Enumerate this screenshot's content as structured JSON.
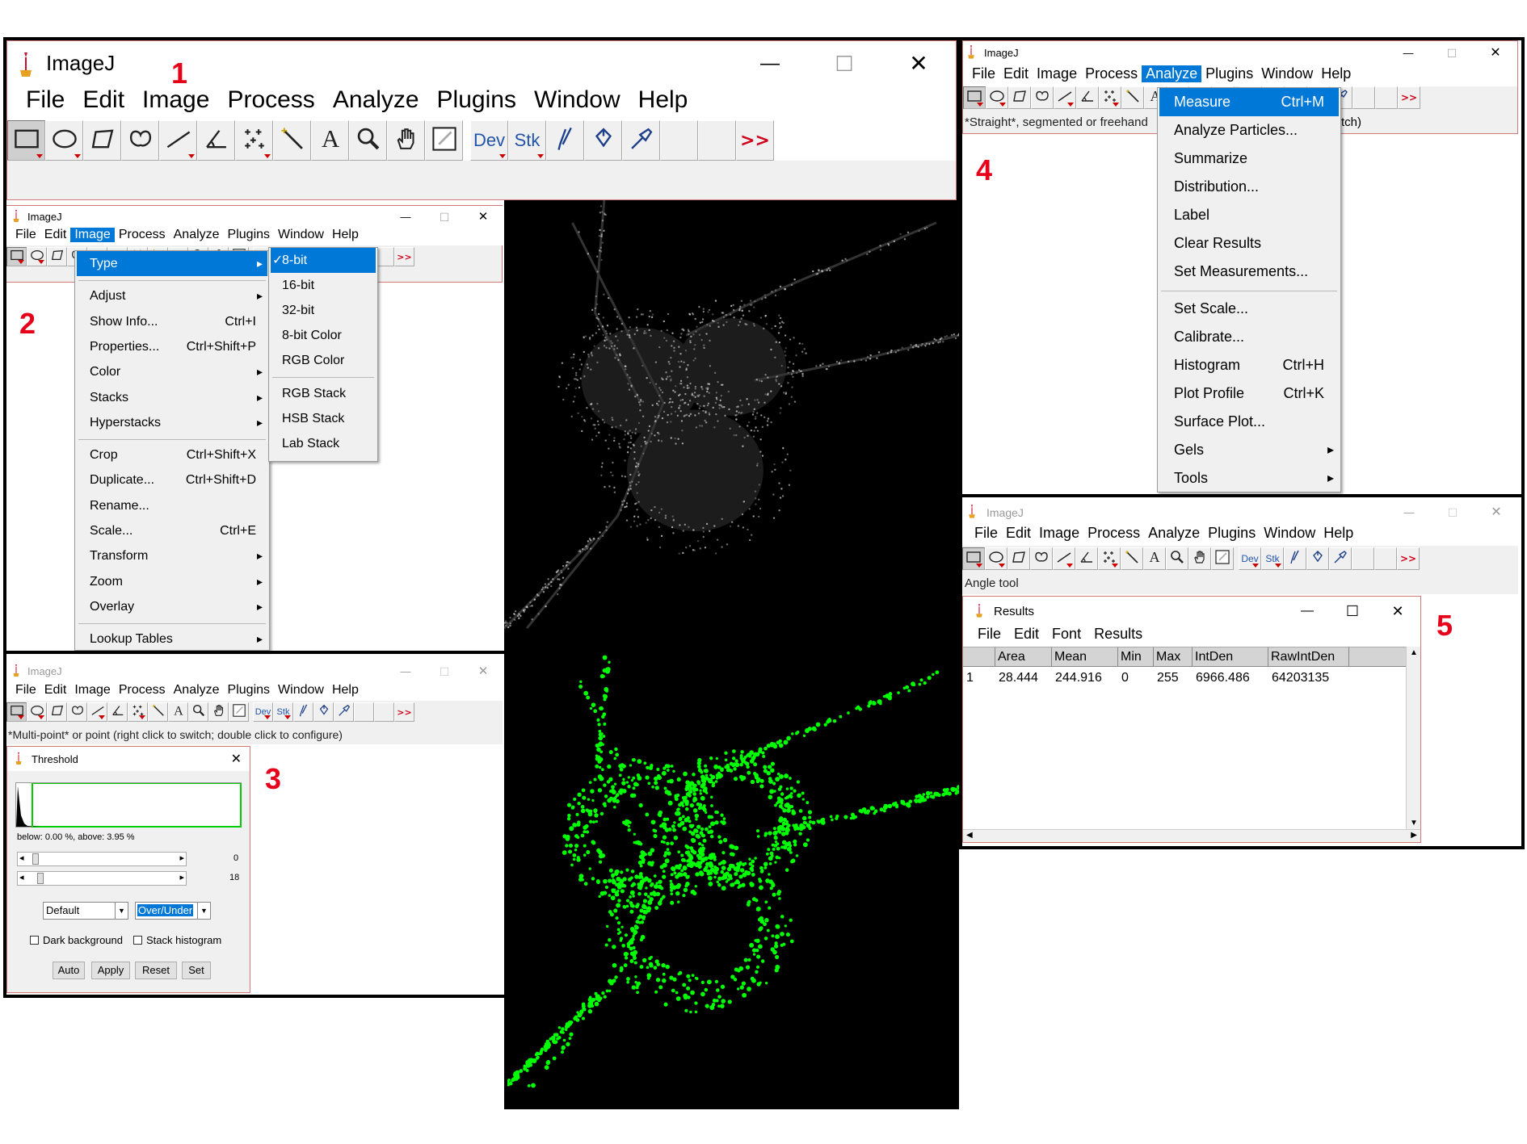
{
  "step_labels": [
    "1",
    "2",
    "3",
    "4",
    "5"
  ],
  "app_title": "ImageJ",
  "window_controls": {
    "minimize": "—",
    "maximize": "☐",
    "close": "✕"
  },
  "menu": [
    "File",
    "Edit",
    "Image",
    "Process",
    "Analyze",
    "Plugins",
    "Window",
    "Help"
  ],
  "tools": {
    "dev": "Dev",
    "stk": "Stk",
    "more": ">>",
    "icons": [
      "rectangle-tool-icon",
      "oval-tool-icon",
      "polygon-tool-icon",
      "freehand-tool-icon",
      "line-tool-icon",
      "angle-tool-icon",
      "multipoint-tool-icon",
      "wand-tool-icon",
      "text-tool-icon",
      "magnifier-tool-icon",
      "hand-tool-icon",
      "color-picker-tool-icon"
    ]
  },
  "win1": {
    "title": "ImageJ"
  },
  "win2": {
    "active_menu": "Image",
    "image_menu": [
      {
        "label": "Type",
        "shortcut": "",
        "submenu": true,
        "highlighted": true
      },
      {
        "label": "Adjust",
        "shortcut": "",
        "submenu": true
      },
      {
        "label": "Show Info...",
        "shortcut": "Ctrl+I"
      },
      {
        "label": "Properties...",
        "shortcut": "Ctrl+Shift+P"
      },
      {
        "label": "Color",
        "shortcut": "",
        "submenu": true
      },
      {
        "label": "Stacks",
        "shortcut": "",
        "submenu": true
      },
      {
        "label": "Hyperstacks",
        "shortcut": "",
        "submenu": true
      },
      {
        "label": "Crop",
        "shortcut": "Ctrl+Shift+X"
      },
      {
        "label": "Duplicate...",
        "shortcut": "Ctrl+Shift+D"
      },
      {
        "label": "Rename...",
        "shortcut": ""
      },
      {
        "label": "Scale...",
        "shortcut": "Ctrl+E"
      },
      {
        "label": "Transform",
        "shortcut": "",
        "submenu": true
      },
      {
        "label": "Zoom",
        "shortcut": "",
        "submenu": true
      },
      {
        "label": "Overlay",
        "shortcut": "",
        "submenu": true
      },
      {
        "label": "Lookup Tables",
        "shortcut": "",
        "submenu": true
      }
    ],
    "type_submenu": [
      {
        "label": "8-bit",
        "checked": true,
        "highlighted": true
      },
      {
        "label": "16-bit"
      },
      {
        "label": "32-bit"
      },
      {
        "label": "8-bit Color"
      },
      {
        "label": "RGB Color"
      },
      {
        "label": "RGB Stack"
      },
      {
        "label": "HSB Stack"
      },
      {
        "label": "Lab Stack"
      }
    ],
    "check_mark": "✓"
  },
  "win3": {
    "status": "*Multi-point* or point (right click to switch; double click to configure)",
    "threshold": {
      "title": "Threshold",
      "stats": "below: 0.00 %,  above: 3.95 %",
      "slider1_value": "0",
      "slider2_value": "18",
      "method": "Default",
      "display_mode": "Over/Under",
      "dark_background": "Dark background",
      "stack_histogram": "Stack histogram",
      "buttons": [
        "Auto",
        "Apply",
        "Reset",
        "Set"
      ]
    }
  },
  "win4": {
    "status_left": "*Straight*, segmented or freehand",
    "status_right": "tch)",
    "active_menu": "Analyze",
    "analyze_menu": [
      {
        "label": "Measure",
        "shortcut": "Ctrl+M",
        "highlighted": true
      },
      {
        "label": "Analyze Particles...",
        "shortcut": ""
      },
      {
        "label": "Summarize",
        "shortcut": ""
      },
      {
        "label": "Distribution...",
        "shortcut": ""
      },
      {
        "label": "Label",
        "shortcut": ""
      },
      {
        "label": "Clear Results",
        "shortcut": ""
      },
      {
        "label": "Set Measurements...",
        "shortcut": ""
      },
      {
        "label": "Set Scale...",
        "shortcut": ""
      },
      {
        "label": "Calibrate...",
        "shortcut": ""
      },
      {
        "label": "Histogram",
        "shortcut": "Ctrl+H"
      },
      {
        "label": "Plot Profile",
        "shortcut": "Ctrl+K"
      },
      {
        "label": "Surface Plot...",
        "shortcut": ""
      },
      {
        "label": "Gels",
        "shortcut": "",
        "submenu": true
      },
      {
        "label": "Tools",
        "shortcut": "",
        "submenu": true
      }
    ]
  },
  "win5": {
    "status": "Angle tool",
    "results": {
      "title": "Results",
      "menu": [
        "File",
        "Edit",
        "Font",
        "Results"
      ],
      "columns": [
        "",
        "Area",
        "Mean",
        "Min",
        "Max",
        "IntDen",
        "RawIntDen"
      ],
      "rows": [
        [
          "1",
          "28.444",
          "244.916",
          "0",
          "255",
          "6966.486",
          "64203135"
        ]
      ]
    }
  },
  "colors": {
    "highlight": "#0078d7",
    "label_red": "#e6001a",
    "threshold_green": "#00ff00",
    "window_border": "#d07a7a"
  }
}
